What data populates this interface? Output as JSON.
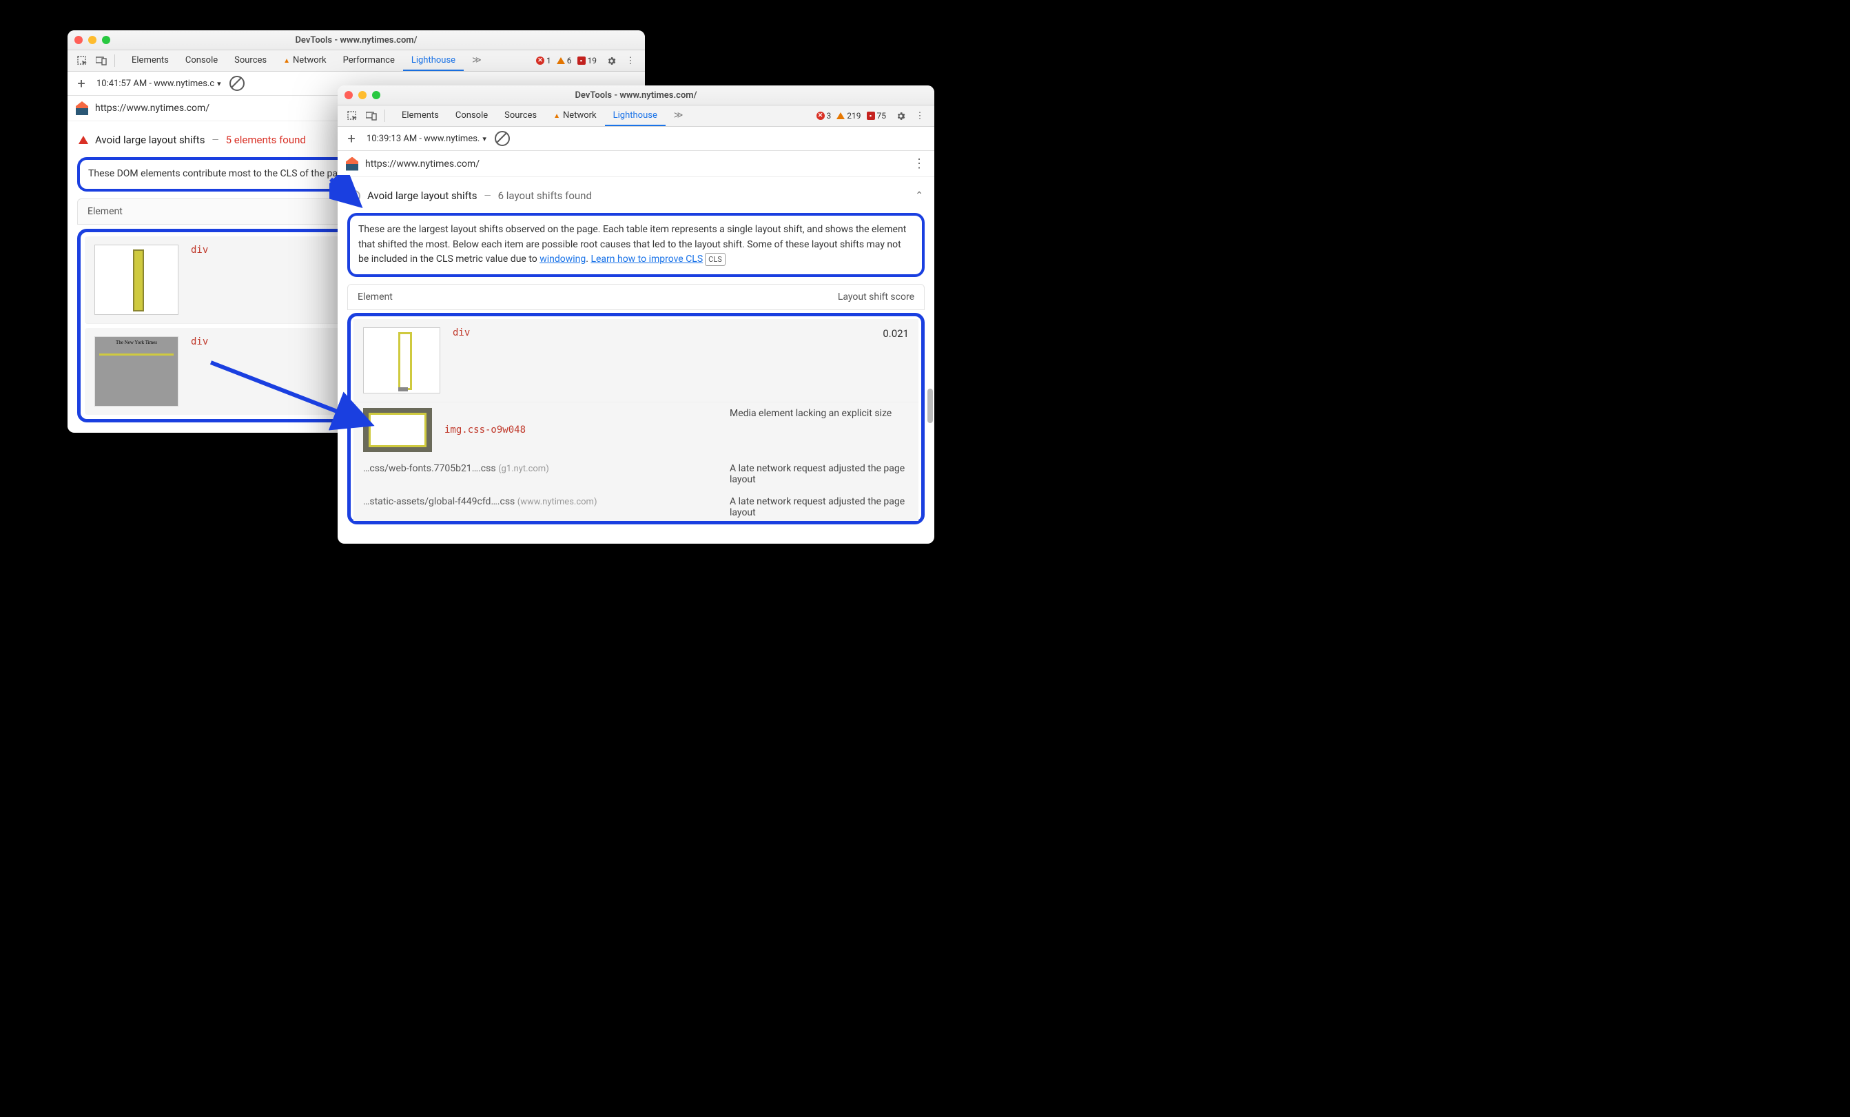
{
  "win1": {
    "title": "DevTools - www.nytimes.com/",
    "tabs": [
      "Elements",
      "Console",
      "Sources",
      "Network",
      "Performance",
      "Lighthouse"
    ],
    "activeTab": "Lighthouse",
    "errors": 1,
    "warnings": 6,
    "issues": 19,
    "timestamp": "10:41:57 AM - www.nytimes.c",
    "url": "https://www.nytimes.com/",
    "audit": {
      "title": "Avoid large layout shifts",
      "sub": "5 elements found",
      "desc": "These DOM elements contribute most to the CLS of the page.",
      "colElement": "Element",
      "rows": [
        {
          "code": "div"
        },
        {
          "code": "div"
        }
      ]
    }
  },
  "win2": {
    "title": "DevTools - www.nytimes.com/",
    "tabs": [
      "Elements",
      "Console",
      "Sources",
      "Network",
      "Lighthouse"
    ],
    "activeTab": "Lighthouse",
    "errors": 3,
    "warnings": 219,
    "issues": 75,
    "timestamp": "10:39:13 AM - www.nytimes.",
    "url": "https://www.nytimes.com/",
    "audit": {
      "title": "Avoid large layout shifts",
      "sub": "6 layout shifts found",
      "desc1": "These are the largest layout shifts observed on the page. Each table item represents a single layout shift, and shows the element that shifted the most. Below each item are possible root causes that led to the layout shift. Some of these layout shifts may not be included in the CLS metric value due to ",
      "link1": "windowing",
      "sep": ". ",
      "link2": "Learn how to improve CLS",
      "colElement": "Element",
      "colScore": "Layout shift score",
      "item": {
        "code": "div",
        "score": "0.021",
        "imgcode": "img.css-o9w048",
        "cause1": "Media element lacking an explicit size",
        "file1": "…css/web-fonts.7705b21….css",
        "host1": "(g1.nyt.com)",
        "cause2": "A late network request adjusted the page layout",
        "file2": "…static-assets/global-f449cfd….css",
        "host2": "(www.nytimes.com)",
        "cause3": "A late network request adjusted the page layout"
      }
    }
  }
}
